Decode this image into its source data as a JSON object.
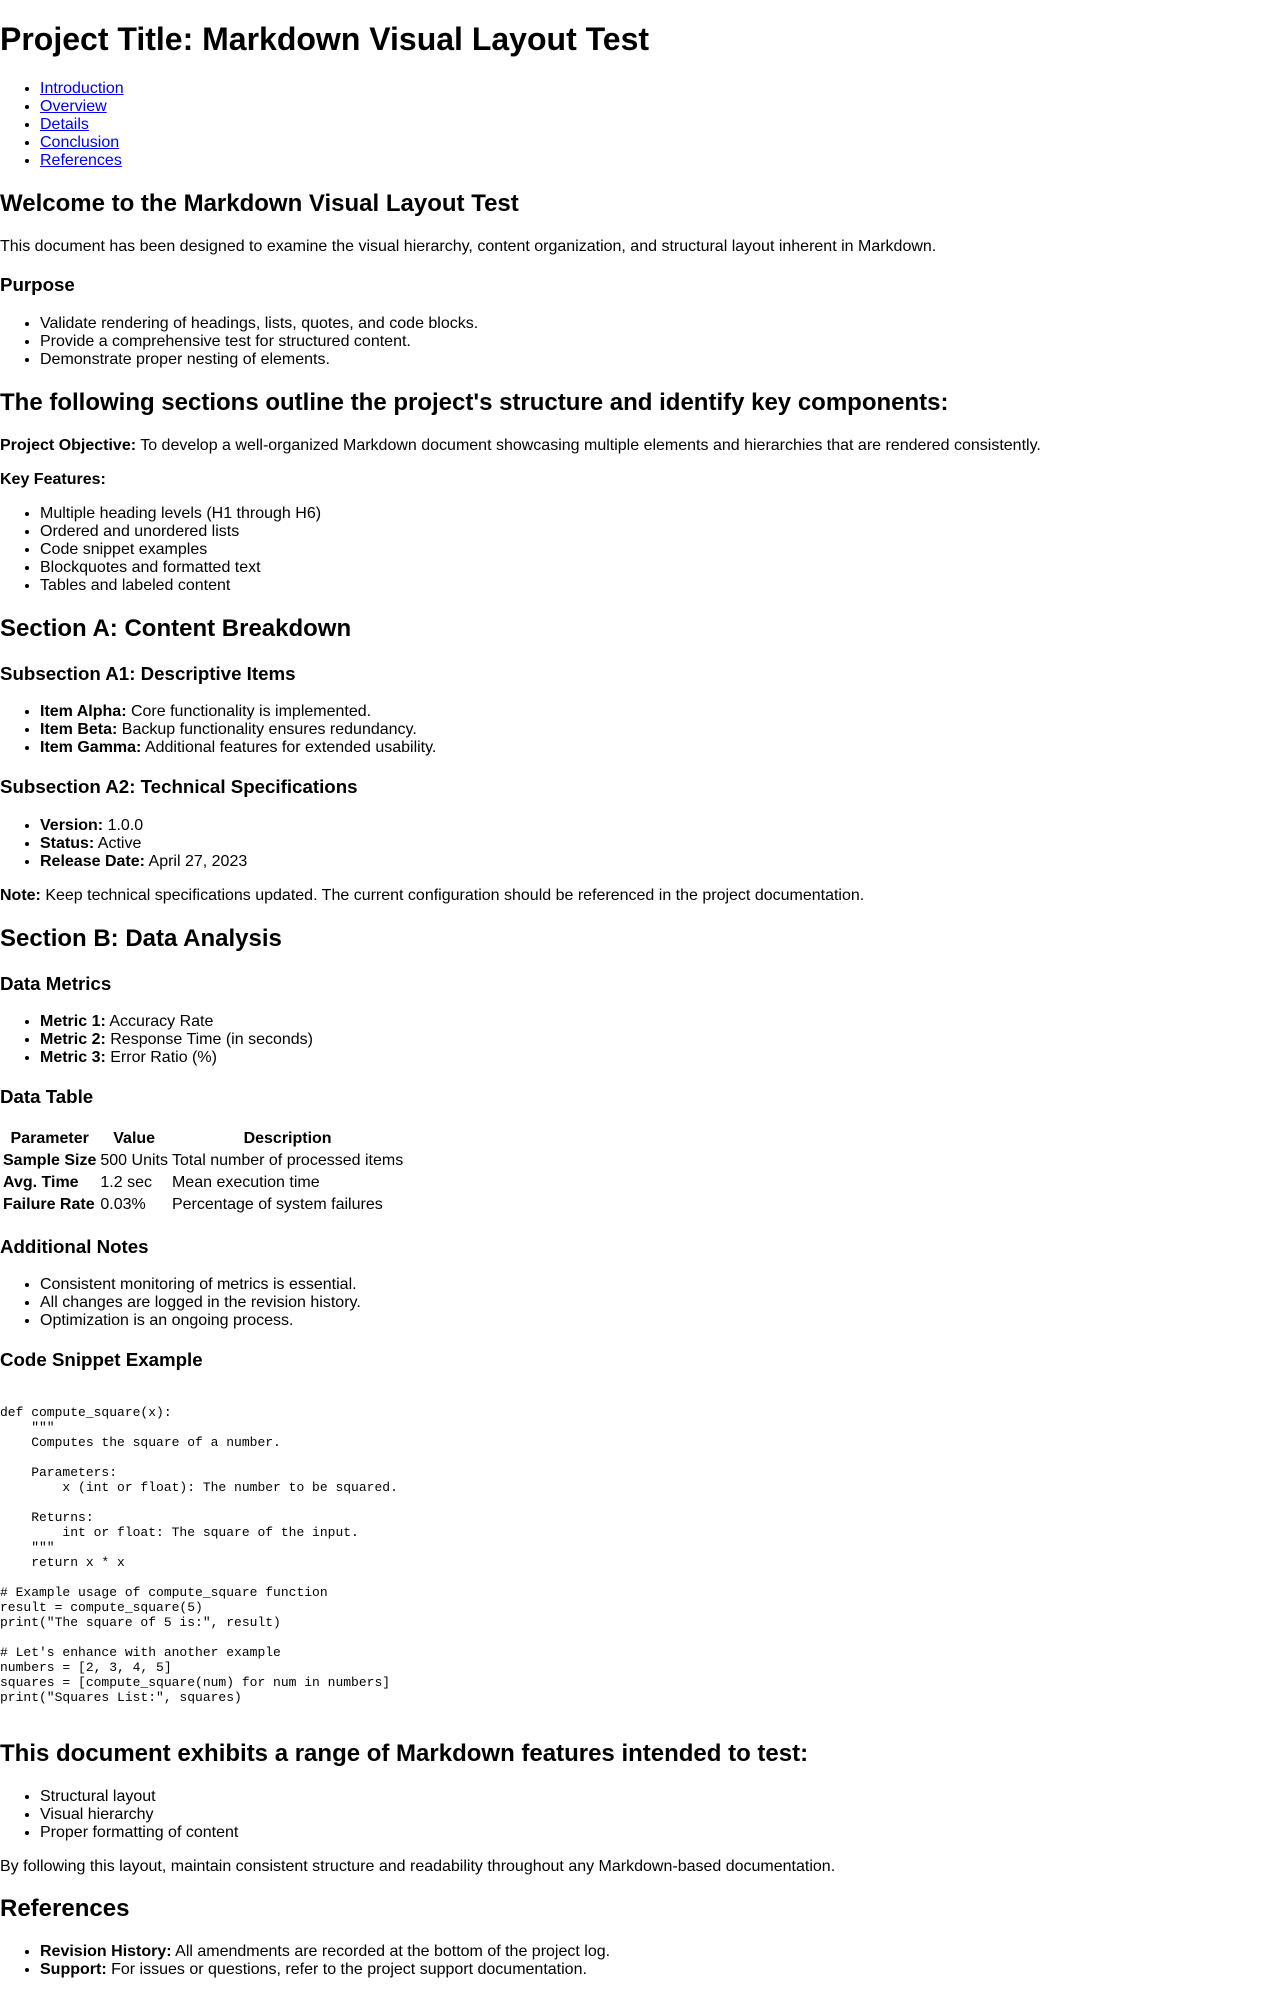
{
  "title": "Project Title: Markdown Visual Layout Test",
  "toc": [
    "Introduction",
    "Overview",
    "Details",
    "Conclusion",
    "References"
  ],
  "welcome": {
    "heading": "Welcome to the Markdown Visual Layout Test",
    "text": "This document has been designed to examine the visual hierarchy, content organization, and structural layout inherent in Markdown."
  },
  "purpose": {
    "heading": "Purpose",
    "items": [
      "Validate rendering of headings, lists, quotes, and code blocks.",
      "Provide a comprehensive test for structured content.",
      "Demonstrate proper nesting of elements."
    ]
  },
  "structure": {
    "heading": "The following sections outline the project's structure and identify key components:",
    "objective_label": "Project Objective:",
    "objective_text": " To develop a well-organized Markdown document showcasing multiple elements and hierarchies that are rendered consistently.",
    "features_label": "Key Features:",
    "features": [
      "Multiple heading levels (H1 through H6)",
      "Ordered and unordered lists",
      "Code snippet examples",
      "Blockquotes and formatted text",
      "Tables and labeled content"
    ]
  },
  "section_a": {
    "heading": "Section A: Content Breakdown",
    "a1_heading": "Subsection A1: Descriptive Items",
    "a1_items": [
      {
        "label": "Item Alpha:",
        "text": " Core functionality is implemented."
      },
      {
        "label": "Item Beta:",
        "text": " Backup functionality ensures redundancy."
      },
      {
        "label": "Item Gamma:",
        "text": " Additional features for extended usability."
      }
    ],
    "a2_heading": "Subsection A2: Technical Specifications",
    "a2_items": [
      {
        "label": "Version:",
        "text": " 1.0.0"
      },
      {
        "label": "Status:",
        "text": " Active"
      },
      {
        "label": "Release Date:",
        "text": " April 27, 2023"
      }
    ],
    "note_label": "Note:",
    "note_text": " Keep technical specifications updated. The current configuration should be referenced in the project documentation."
  },
  "section_b": {
    "heading": "Section B: Data Analysis",
    "metrics_heading": "Data Metrics",
    "metrics": [
      {
        "label": "Metric 1:",
        "text": " Accuracy Rate"
      },
      {
        "label": "Metric 2:",
        "text": " Response Time (in seconds)"
      },
      {
        "label": "Metric 3:",
        "text": " Error Ratio (%)"
      }
    ],
    "table_heading": "Data Table",
    "table": {
      "headers": [
        "Parameter",
        "Value",
        "Description"
      ],
      "rows": [
        [
          "Sample Size",
          "500 Units",
          "Total number of processed items"
        ],
        [
          "Avg. Time",
          "1.2 sec",
          "Mean execution time"
        ],
        [
          "Failure Rate",
          "0.03%",
          "Percentage of system failures"
        ]
      ]
    },
    "notes_heading": "Additional Notes",
    "notes": [
      "Consistent monitoring of metrics is essential.",
      "All changes are logged in the revision history.",
      "Optimization is an ongoing process."
    ],
    "code_heading": "Code Snippet Example",
    "code": "def compute_square(x):\n    \"\"\"\n    Computes the square of a number.\n\n    Parameters:\n        x (int or float): The number to be squared.\n\n    Returns:\n        int or float: The square of the input.\n    \"\"\"\n    return x * x\n\n# Example usage of compute_square function\nresult = compute_square(5)\nprint(\"The square of 5 is:\", result)\n\n# Let's enhance with another example\nnumbers = [2, 3, 4, 5]\nsquares = [compute_square(num) for num in numbers]\nprint(\"Squares List:\", squares)"
  },
  "conclusion": {
    "heading": "This document exhibits a range of Markdown features intended to test:",
    "items": [
      "Structural layout",
      "Visual hierarchy",
      "Proper formatting of content"
    ],
    "text": "By following this layout, maintain consistent structure and readability throughout any Markdown-based documentation."
  },
  "references": {
    "heading": "References",
    "items": [
      {
        "label": "Revision History:",
        "text": " All amendments are recorded at the bottom of the project log."
      },
      {
        "label": "Support:",
        "text": " For issues or questions, refer to the project support documentation."
      }
    ]
  }
}
